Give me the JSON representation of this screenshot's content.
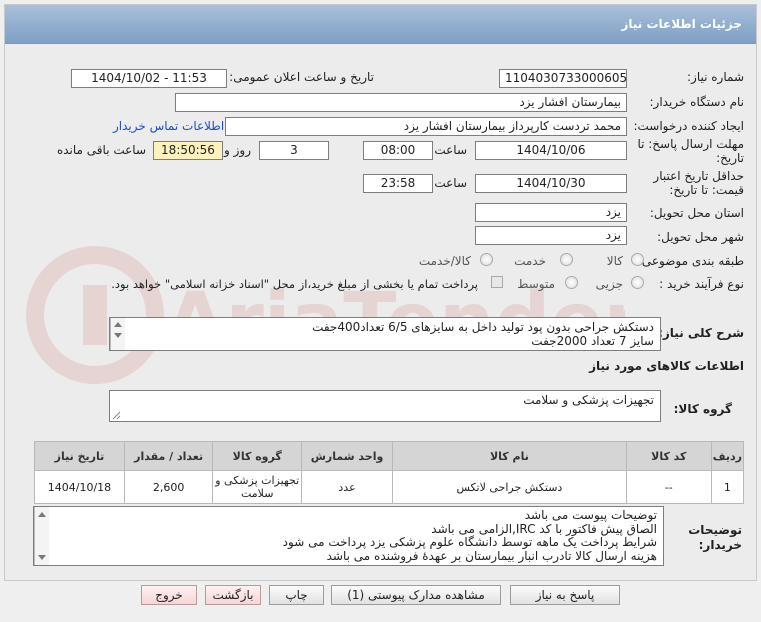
{
  "header": {
    "title": "جزئیات اطلاعات نیاز"
  },
  "form": {
    "need_number": {
      "label": "شماره نیاز:",
      "value": "1104030733000605"
    },
    "announce_datetime": {
      "label": "تاریخ و ساعت اعلان عمومی:",
      "value": "1404/10/02 - 11:53"
    },
    "buyer_org": {
      "label": "نام دستگاه خریدار:",
      "value": "بیمارستان افشار یزد"
    },
    "requester": {
      "label": "ایجاد کننده درخواست:",
      "value": "محمد تردست کارپرداز بیمارستان افشار یزد",
      "contact_link": "اطلاعات تماس خریدار"
    },
    "deadline": {
      "label_line1": "مهلت ارسال پاسخ: تا",
      "label_line2": "تاریخ:",
      "date": "1404/10/06",
      "time_label": "ساعت",
      "time": "08:00",
      "days": "3",
      "days_label": "روز و",
      "remaining": "18:50:56",
      "remaining_label": "ساعت باقی مانده"
    },
    "validity": {
      "label_line1": "حداقل تاریخ اعتبار",
      "label_line2": "قیمت: تا تاریخ:",
      "date": "1404/10/30",
      "time_label": "ساعت",
      "time": "23:58"
    },
    "province": {
      "label": "استان محل تحویل:",
      "value": "یزد"
    },
    "city": {
      "label": "شهر محل تحویل:",
      "value": "یزد"
    },
    "category": {
      "label": "طبقه بندی موضوعی:",
      "options": [
        "کالا",
        "خدمت",
        "کالا/خدمت"
      ]
    },
    "purchase_type": {
      "label": "نوع فرآیند خرید :",
      "options": [
        "جزیی",
        "متوسط"
      ],
      "note": "پرداخت تمام یا بخشی از مبلغ خرید،از محل \"اسناد خزانه اسلامی\" خواهد بود."
    },
    "description": {
      "label": "شرح کلی نیاز:",
      "line1": "دستکش جراحی بدون پود تولید داخل به سایزهای 6/5 تعداد400جفت",
      "line2": "سایز 7 تعداد 2000جفت"
    },
    "goods_info_title": "اطلاعات کالاهای مورد نیاز",
    "goods_group": {
      "label": "گروه کالا:",
      "value": "تجهیزات پزشکی و سلامت"
    }
  },
  "table": {
    "headers": [
      "ردیف",
      "کد کالا",
      "نام کالا",
      "واحد شمارش",
      "گروه کالا",
      "تعداد / مقدار",
      "تاریخ نیاز"
    ],
    "rows": [
      [
        "1",
        "--",
        "دستکش جراحی لاتکس",
        "عدد",
        "تجهیزات پزشکی و سلامت",
        "2,600",
        "1404/10/18"
      ]
    ]
  },
  "buyer_notes": {
    "label_line1": "توضیحات",
    "label_line2": "خریدار:",
    "lines": [
      "توضیحات پیوست می باشد",
      "الصاق پیش فاکتور با کد  IRC,الزامی می باشد",
      "شرایط پرداخت  یک ماهه توسط دانشگاه علوم پزشکی   یزد پرداخت می شود",
      "هزینه ارسال کالا تادرب انبار بیمارستان بر عهدهٔ فروشنده می باشد"
    ]
  },
  "buttons": {
    "reply": "پاسخ به نیاز",
    "attachments": "مشاهده مدارک پیوستی (1)",
    "print": "چاپ",
    "back": "بازگشت",
    "exit": "خروج"
  },
  "watermark": {
    "text": "AriaTender.net"
  },
  "colors": {
    "title_bar": "#8ea9cd",
    "link": "#1a4fc9",
    "remaining_bg": "#fdf2bd"
  }
}
